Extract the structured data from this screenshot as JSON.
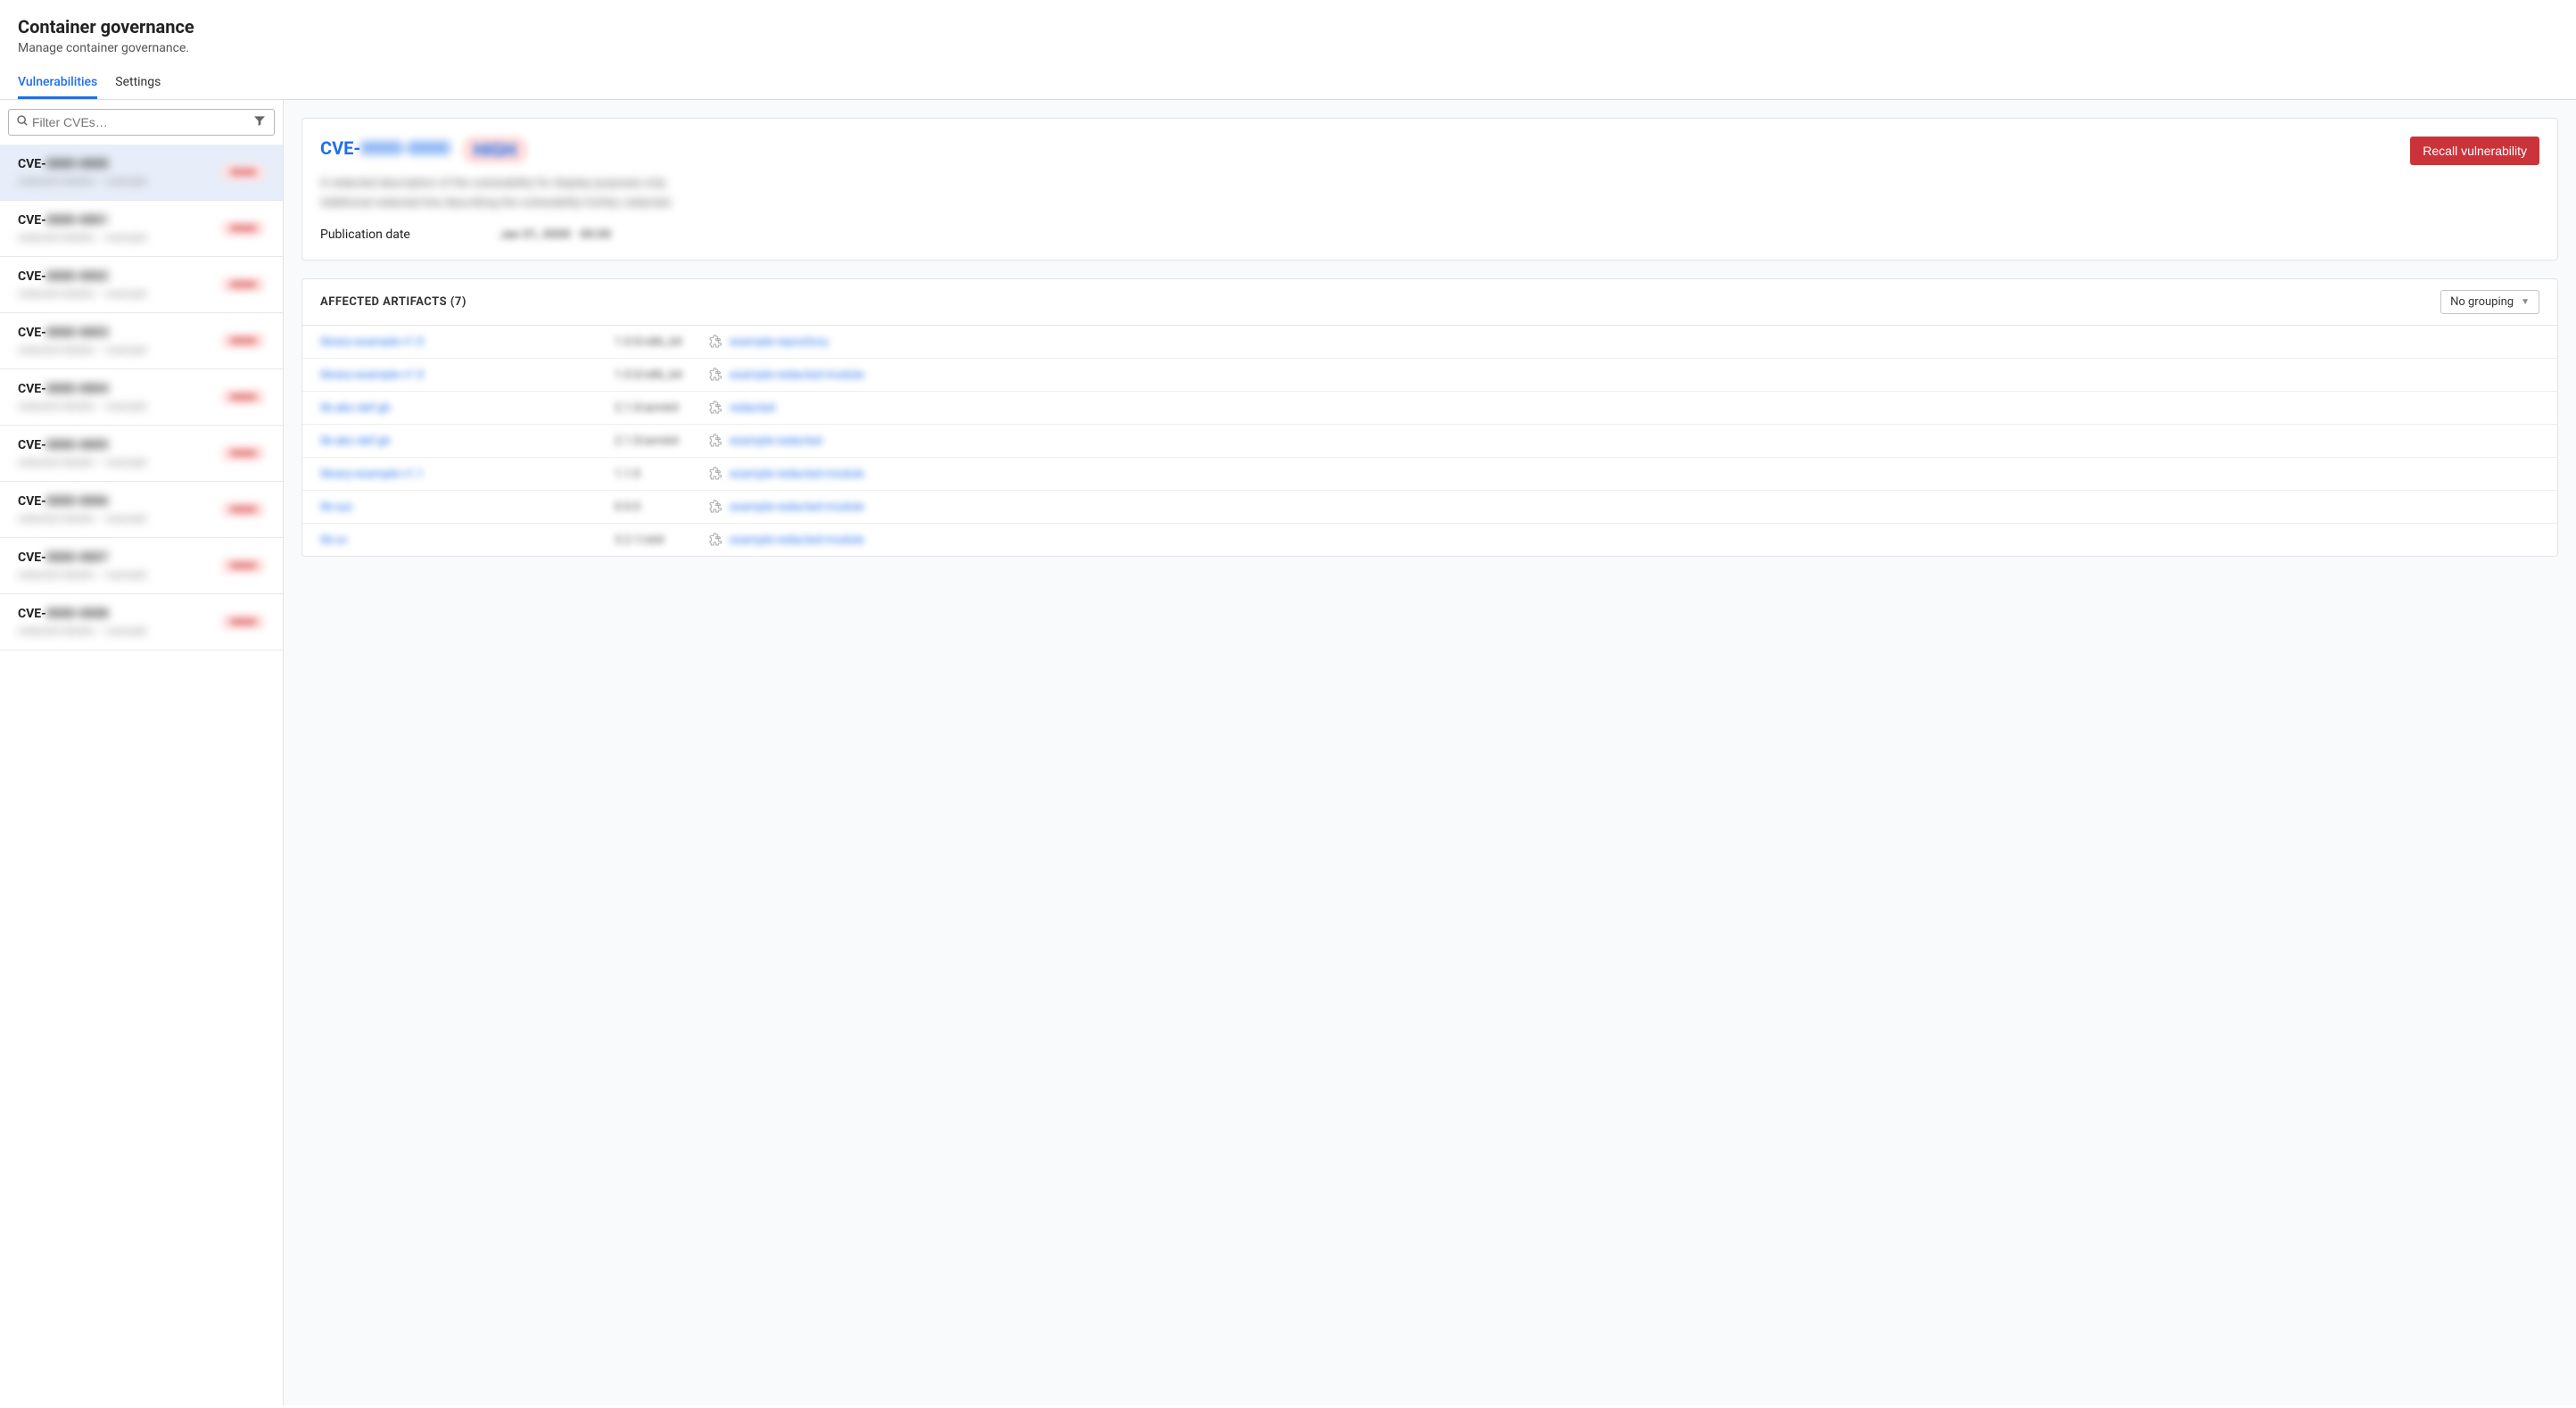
{
  "header": {
    "title": "Container governance",
    "subtitle": "Manage container governance."
  },
  "tabs": {
    "vulnerabilities": "Vulnerabilities",
    "settings": "Settings"
  },
  "search": {
    "placeholder": "Filter CVEs…"
  },
  "cve_list": [
    {
      "id_prefix": "CVE-",
      "id_hidden": "0000-0000",
      "sub_hidden": "redacted details – example",
      "badge_hidden": "HIGH",
      "selected": true
    },
    {
      "id_prefix": "CVE-",
      "id_hidden": "0000-0001",
      "sub_hidden": "redacted details – example",
      "badge_hidden": "HIGH",
      "selected": false
    },
    {
      "id_prefix": "CVE-",
      "id_hidden": "0000-0002",
      "sub_hidden": "redacted details – example",
      "badge_hidden": "HIGH",
      "selected": false
    },
    {
      "id_prefix": "CVE-",
      "id_hidden": "0000-0003",
      "sub_hidden": "redacted details – example",
      "badge_hidden": "HIGH",
      "selected": false
    },
    {
      "id_prefix": "CVE-",
      "id_hidden": "0000-0004",
      "sub_hidden": "redacted details – example",
      "badge_hidden": "HIGH",
      "selected": false
    },
    {
      "id_prefix": "CVE-",
      "id_hidden": "0000-0005",
      "sub_hidden": "redacted details – example",
      "badge_hidden": "HIGH",
      "selected": false
    },
    {
      "id_prefix": "CVE-",
      "id_hidden": "0000-0006",
      "sub_hidden": "redacted details – example",
      "badge_hidden": "HIGH",
      "selected": false
    },
    {
      "id_prefix": "CVE-",
      "id_hidden": "0000-0007",
      "sub_hidden": "redacted details – example",
      "badge_hidden": "HIGH",
      "selected": false
    },
    {
      "id_prefix": "CVE-",
      "id_hidden": "0000-0008",
      "sub_hidden": "redacted details – example",
      "badge_hidden": "HIGH",
      "selected": false
    }
  ],
  "detail": {
    "title_prefix": "CVE-",
    "title_hidden": "0000-0000",
    "badge_hidden": "HIGH",
    "desc_line1_hidden": "A redacted description of the vulnerability for display purposes only.",
    "desc_line2_hidden": "Additional redacted line describing the vulnerability further, redacted.",
    "pub_label": "Publication date",
    "pub_value_hidden": "Jan 01, 0000 · 00:00",
    "recall_btn": "Recall vulnerability"
  },
  "artifacts": {
    "title": "AFFECTED ARTIFACTS (7)",
    "grouping_label": "No grouping",
    "rows": [
      {
        "name_hidden": "library-example-v1.0",
        "ver_hidden": "1.0.0/x86_64",
        "link_hidden": "example-repository"
      },
      {
        "name_hidden": "library-example-v1.0",
        "ver_hidden": "1.0.0/x86_64",
        "link_hidden": "example-redacted-module"
      },
      {
        "name_hidden": "lib-abc-def-gh",
        "ver_hidden": "2.1.0/arm64",
        "link_hidden": "redacted"
      },
      {
        "name_hidden": "lib-abc-def-gh",
        "ver_hidden": "2.1.0/arm64",
        "link_hidden": "example-redacted"
      },
      {
        "name_hidden": "library-example-v1.1",
        "ver_hidden": "1.1.0",
        "link_hidden": "example-redacted-module"
      },
      {
        "name_hidden": "lib-xyz",
        "ver_hidden": "0.9.0",
        "link_hidden": "example-redacted-module"
      },
      {
        "name_hidden": "lib-uv",
        "ver_hidden": "3.2.1/x64",
        "link_hidden": "example-redacted-module"
      }
    ]
  }
}
